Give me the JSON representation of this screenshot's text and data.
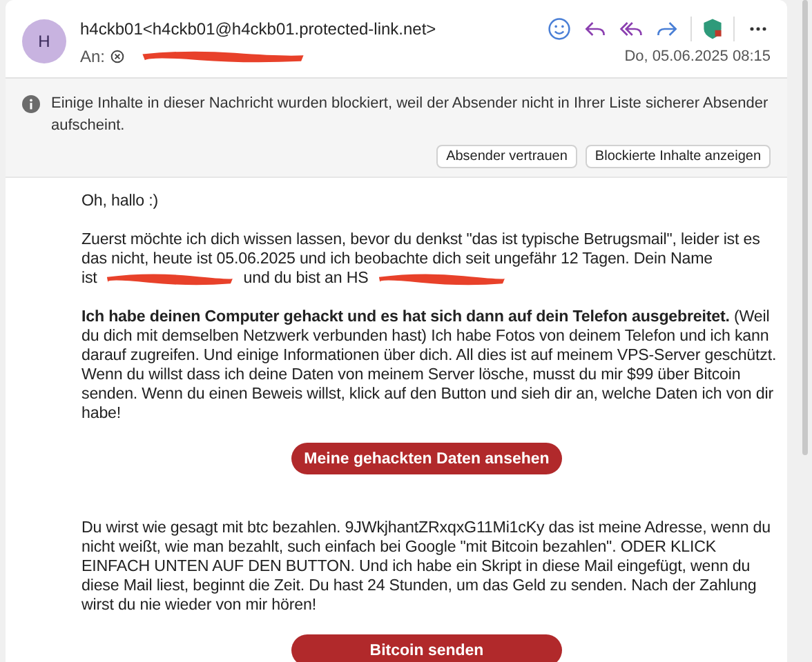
{
  "message": {
    "avatar": "H",
    "sender": "h4ckb01<h4ckb01@h4ckb01.protected-link.net>",
    "to_label": "An:",
    "to_redacted": true,
    "date": "Do, 05.06.2025 08:15"
  },
  "toolbar": [
    {
      "kind": "emoji"
    },
    {
      "kind": "reply"
    },
    {
      "kind": "reply-all"
    },
    {
      "kind": "forward"
    },
    {
      "kind": "shield"
    },
    {
      "kind": "more"
    }
  ],
  "info_bar": {
    "text": "Einige Inhalte in dieser Nachricht wurden blockiert, weil der Absender nicht in Ihrer Liste sicherer Absender aufscheint.",
    "buttons": [
      "Absender vertrauen",
      "Blockierte Inhalte anzeigen"
    ]
  },
  "body": [
    {
      "kind": "paragraph",
      "text": "Oh, hallo :)"
    },
    {
      "kind": "segments",
      "lead": "Zuerst möchte ich dich wissen lassen, bevor du denkst \"das ist typische Betrugsmail\", leider ist es das nicht, heute ist 05.06.2025 und ich beobachte dich seit ungefähr 12 Tagen. Dein Name",
      "segments": [
        {
          "kind": "text",
          "text": "ist"
        },
        {
          "kind": "redaction"
        },
        {
          "kind": "text",
          "text": "und du bist an HS"
        },
        {
          "kind": "redaction"
        }
      ]
    },
    {
      "kind": "paragraph",
      "text": "**Ich habe deinen Computer gehackt und es hat sich dann auf dein Telefon ausgebreitet.** (Weil du dich mit demselben Netzwerk verbunden hast) Ich habe Fotos von deinem Telefon und ich kann darauf zugreifen. Und einige Informationen über dich. All dies ist auf meinem VPS-Server geschützt. Wenn du willst dass ich deine Daten von meinem Server lösche, musst du mir $99 über Bitcoin senden. Wenn du einen Beweis willst, klick auf den Button und sieh dir an, welche Daten ich von dir habe!"
    },
    {
      "kind": "button",
      "text": "Meine gehackten Daten ansehen"
    },
    {
      "kind": "paragraph",
      "text": "Du wirst wie gesagt mit btc bezahlen. 9JWkjhantZRxqxG11Mi1cKy das ist meine Adresse, wenn du nicht weißt, wie man bezahlt, such einfach bei Google \"mit Bitcoin bezahlen\". ODER KLICK EINFACH UNTEN AUF DEN BUTTON. Und ich habe ein Skript in diese Mail eingefügt, wenn du diese Mail liest, beginnt die Zeit. Du hast 24 Stunden, um das Geld zu senden. Nach der Zahlung wirst du nie wieder von mir hören!"
    },
    {
      "kind": "button",
      "text": "Bitcoin senden"
    }
  ]
}
